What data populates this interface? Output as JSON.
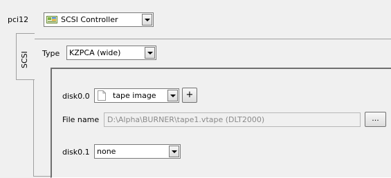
{
  "top": {
    "slot_label": "pci12",
    "controller_selected": "SCSI Controller"
  },
  "tabs": [
    {
      "label": "SCSI"
    }
  ],
  "scsi": {
    "type_label": "Type",
    "type_value": "KZPCA (wide)",
    "disk0_0": {
      "label": "disk0.0",
      "value": "tape image",
      "add_button": "+"
    },
    "file_name": {
      "label": "File name",
      "value": "D:\\Alpha\\BURNER\\tape1.vtape (DLT2000)",
      "browse_button": "..."
    },
    "disk0_1": {
      "label": "disk0.1",
      "value": "none"
    }
  }
}
